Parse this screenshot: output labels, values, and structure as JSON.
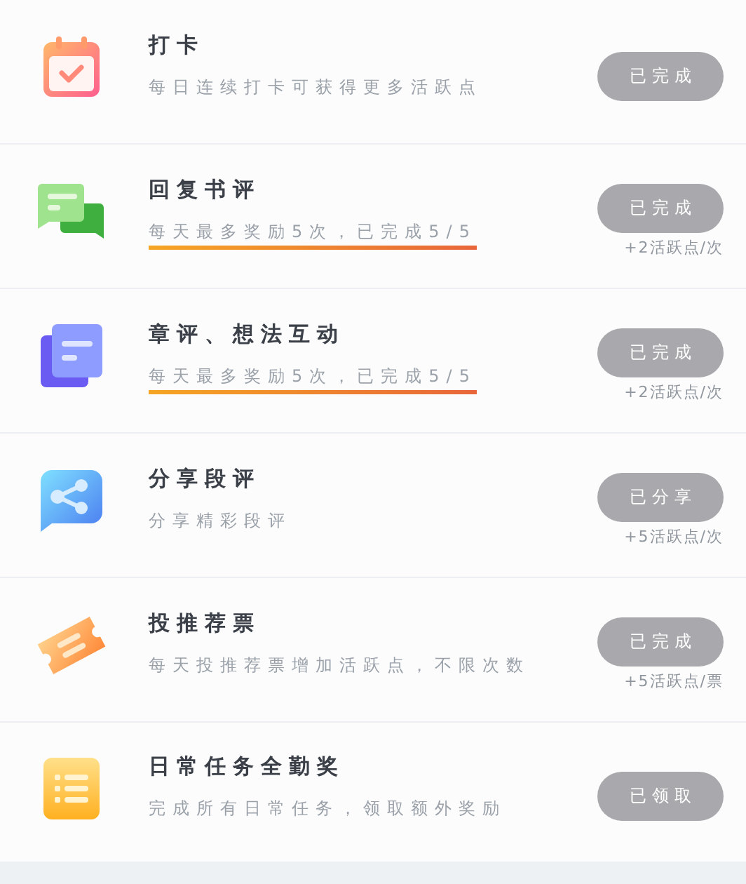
{
  "tasks": [
    {
      "kind": "calendar",
      "title": "打卡",
      "subtitle": "每日连续打卡可获得更多活跃点",
      "underlined": false,
      "button": "已完成",
      "disabled": true
    },
    {
      "kind": "chat",
      "title": "回复书评",
      "subtitle": "每天最多奖励5次，已完成5/5",
      "underlined": true,
      "button": "已完成",
      "disabled": true,
      "reward": "+2活跃点/次"
    },
    {
      "kind": "pages",
      "title": "章评、想法互动",
      "subtitle": "每天最多奖励5次，已完成5/5",
      "underlined": true,
      "button": "已完成",
      "disabled": true,
      "reward": "+2活跃点/次"
    },
    {
      "kind": "share",
      "title": "分享段评",
      "subtitle": "分享精彩段评",
      "underlined": false,
      "button": "已分享",
      "disabled": true,
      "reward": "+5活跃点/次"
    },
    {
      "kind": "ticket",
      "title": "投推荐票",
      "subtitle": "每天投推荐票增加活跃点，不限次数",
      "underlined": false,
      "button": "已完成",
      "disabled": true,
      "reward": "+5活跃点/票"
    },
    {
      "kind": "list",
      "title": "日常任务全勤奖",
      "subtitle": "完成所有日常任务，领取额外奖励",
      "underlined": false,
      "button": "已领取",
      "disabled": true
    }
  ]
}
